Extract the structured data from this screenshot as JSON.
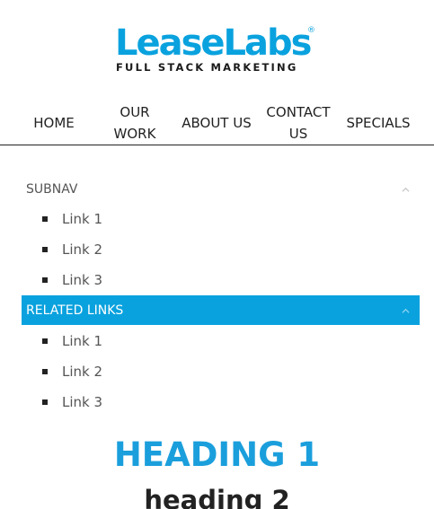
{
  "logo": {
    "main": "LeaseLabs",
    "registered": "®",
    "tagline": "FULL STACK MARKETING",
    "color": "#0aa2de"
  },
  "nav": {
    "items": [
      {
        "label": "HOME"
      },
      {
        "label": "OUR WORK"
      },
      {
        "label": "ABOUT US"
      },
      {
        "label": "CONTACT US"
      },
      {
        "label": "SPECIALS"
      }
    ]
  },
  "subnav": {
    "title": "SUBNAV",
    "links": [
      "Link 1",
      "Link 2",
      "Link 3"
    ]
  },
  "related": {
    "title": "RELATED LINKS",
    "active_color": "#0aa2de",
    "links": [
      "Link 1",
      "Link 2",
      "Link 3"
    ]
  },
  "content": {
    "heading1": "HEADING 1",
    "heading2": "heading 2"
  }
}
